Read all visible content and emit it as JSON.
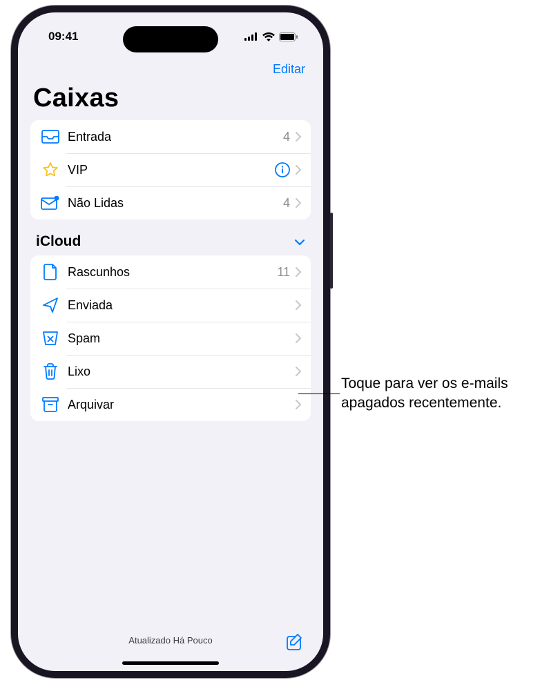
{
  "status": {
    "time": "09:41"
  },
  "nav": {
    "edit": "Editar"
  },
  "title": "Caixas",
  "mailboxes": {
    "inbox": {
      "label": "Entrada",
      "count": "4"
    },
    "vip": {
      "label": "VIP"
    },
    "unread": {
      "label": "Não Lidas",
      "count": "4"
    }
  },
  "section": {
    "icloud": "iCloud"
  },
  "icloud": {
    "drafts": {
      "label": "Rascunhos",
      "count": "11"
    },
    "sent": {
      "label": "Enviada"
    },
    "junk": {
      "label": "Spam"
    },
    "trash": {
      "label": "Lixo"
    },
    "archive": {
      "label": "Arquivar"
    }
  },
  "toolbar": {
    "status": "Atualizado Há Pouco"
  },
  "callout": {
    "text": "Toque para ver os e-mails apagados recentemente."
  }
}
